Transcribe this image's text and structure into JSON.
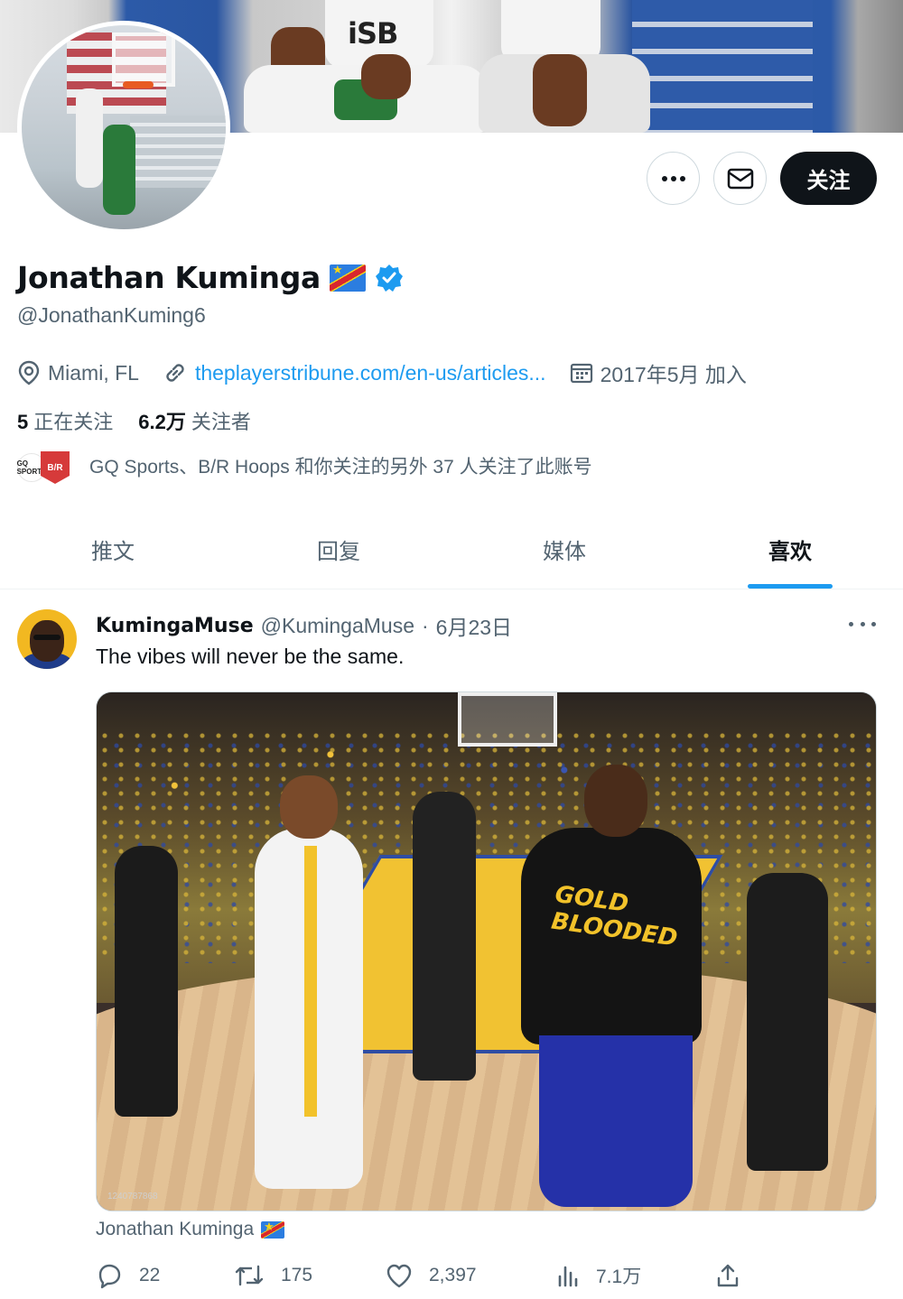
{
  "profile": {
    "display_name": "Jonathan Kuminga",
    "handle": "@JonathanKuming6",
    "location": "Miami, FL",
    "website": "theplayerstribune.com/en-us/articles...",
    "joined": "2017年5月 加入",
    "following_count": "5",
    "following_label": "正在关注",
    "followers_count": "6.2万",
    "followers_label": "关注者",
    "known_followers_text": "GQ Sports、B/R Hoops 和你关注的另外 37 人关注了此账号",
    "known_avatar_1": "GQ SPORTS",
    "known_avatar_2": "B/R",
    "follow_button": "关注",
    "banner_text": "iSB"
  },
  "tabs": [
    {
      "label": "推文"
    },
    {
      "label": "回复"
    },
    {
      "label": "媒体"
    },
    {
      "label": "喜欢"
    }
  ],
  "tweet": {
    "author": "KumingaMuse",
    "handle": "@KumingaMuse",
    "separator": "·",
    "date": "6月23日",
    "text": "The vibes will never be the same.",
    "media_shirt_text": "GOLD BLOODED",
    "media_watermark": "1240787868",
    "tagged_user": "Jonathan Kuminga",
    "replies": "22",
    "retweets": "175",
    "likes": "2,397",
    "views": "7.1万"
  },
  "colors": {
    "accent": "#1d9bf0",
    "text_primary": "#0f1419",
    "text_secondary": "#536471",
    "follow_button_bg": "#0f1419"
  },
  "icons": {
    "more": "more-horizontal-icon",
    "message": "envelope-icon",
    "location": "location-pin-icon",
    "link": "link-icon",
    "calendar": "calendar-icon",
    "verified": "verified-badge-icon",
    "reply": "reply-icon",
    "retweet": "retweet-icon",
    "like": "heart-icon",
    "views": "views-chart-icon",
    "share": "share-icon"
  }
}
